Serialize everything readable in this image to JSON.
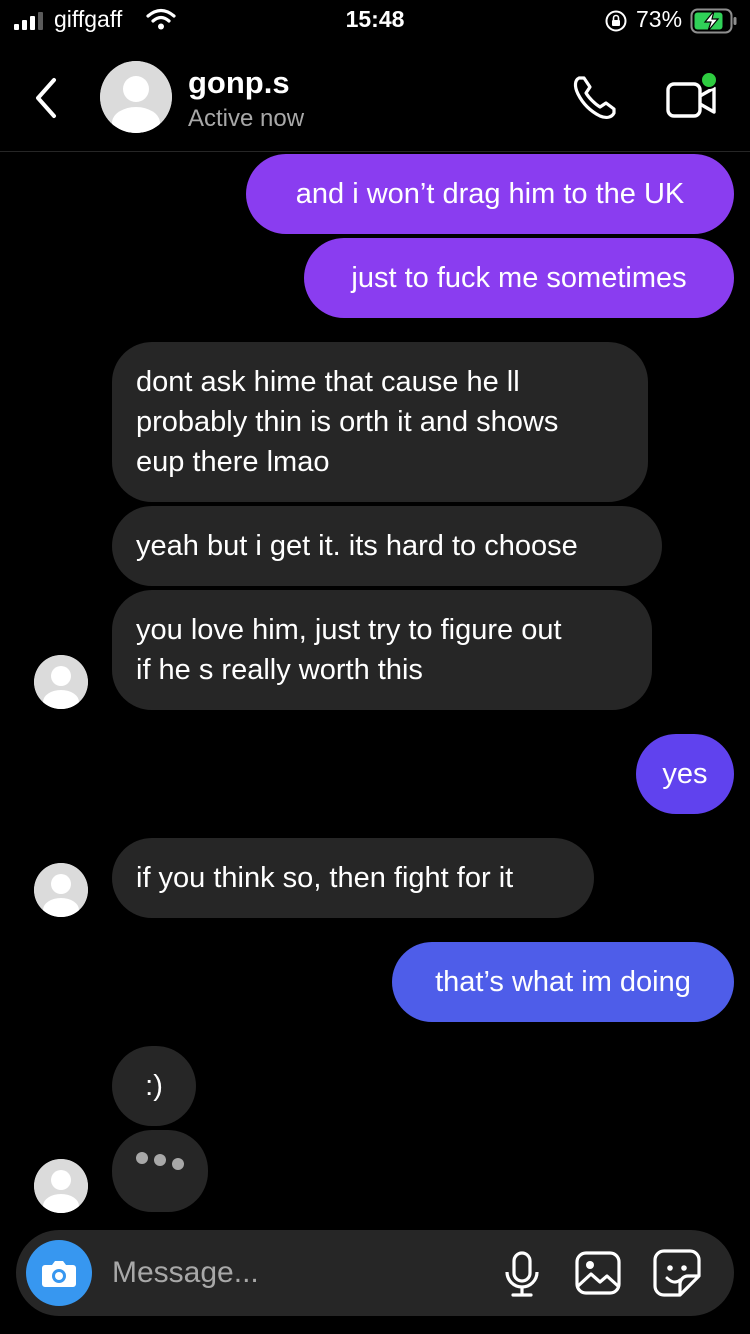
{
  "status_bar": {
    "carrier": "giffgaff",
    "time": "15:48",
    "battery": "73%"
  },
  "header": {
    "name": "gonp.s",
    "status": "Active now"
  },
  "messages": [
    {
      "text": "and i won’t drag him to the UK",
      "from": "me",
      "color": "#8a3df0"
    },
    {
      "text": "just to fuck me sometimes",
      "from": "me",
      "color": "#8a3df0"
    },
    {
      "text": "dont ask hime that cause he ll\nprobably thin is orth it and shows\neup there lmao",
      "from": "them"
    },
    {
      "text": "yeah but i get it. its hard to choose",
      "from": "them"
    },
    {
      "text": "you love him, just try to figure out\nif he s really worth this",
      "from": "them"
    },
    {
      "text": "yes",
      "from": "me",
      "color": "#6042ee"
    },
    {
      "text": "if you think so, then fight for it",
      "from": "them"
    },
    {
      "text": "that’s what im doing",
      "from": "me",
      "color": "#4e5de9"
    },
    {
      "text": ":)",
      "from": "them"
    }
  ],
  "composer": {
    "placeholder": "Message..."
  },
  "icons": [
    "cellular-signal-icon",
    "wifi-icon",
    "orientation-lock-icon",
    "battery-charging-icon",
    "back-chevron-icon",
    "phone-call-icon",
    "video-call-icon",
    "camera-icon",
    "microphone-icon",
    "gallery-icon",
    "sticker-icon"
  ],
  "colors": {
    "background": "#000000",
    "received_bubble": "#262626",
    "camera_button": "#3797f0",
    "active_dot": "#2ecc40"
  }
}
